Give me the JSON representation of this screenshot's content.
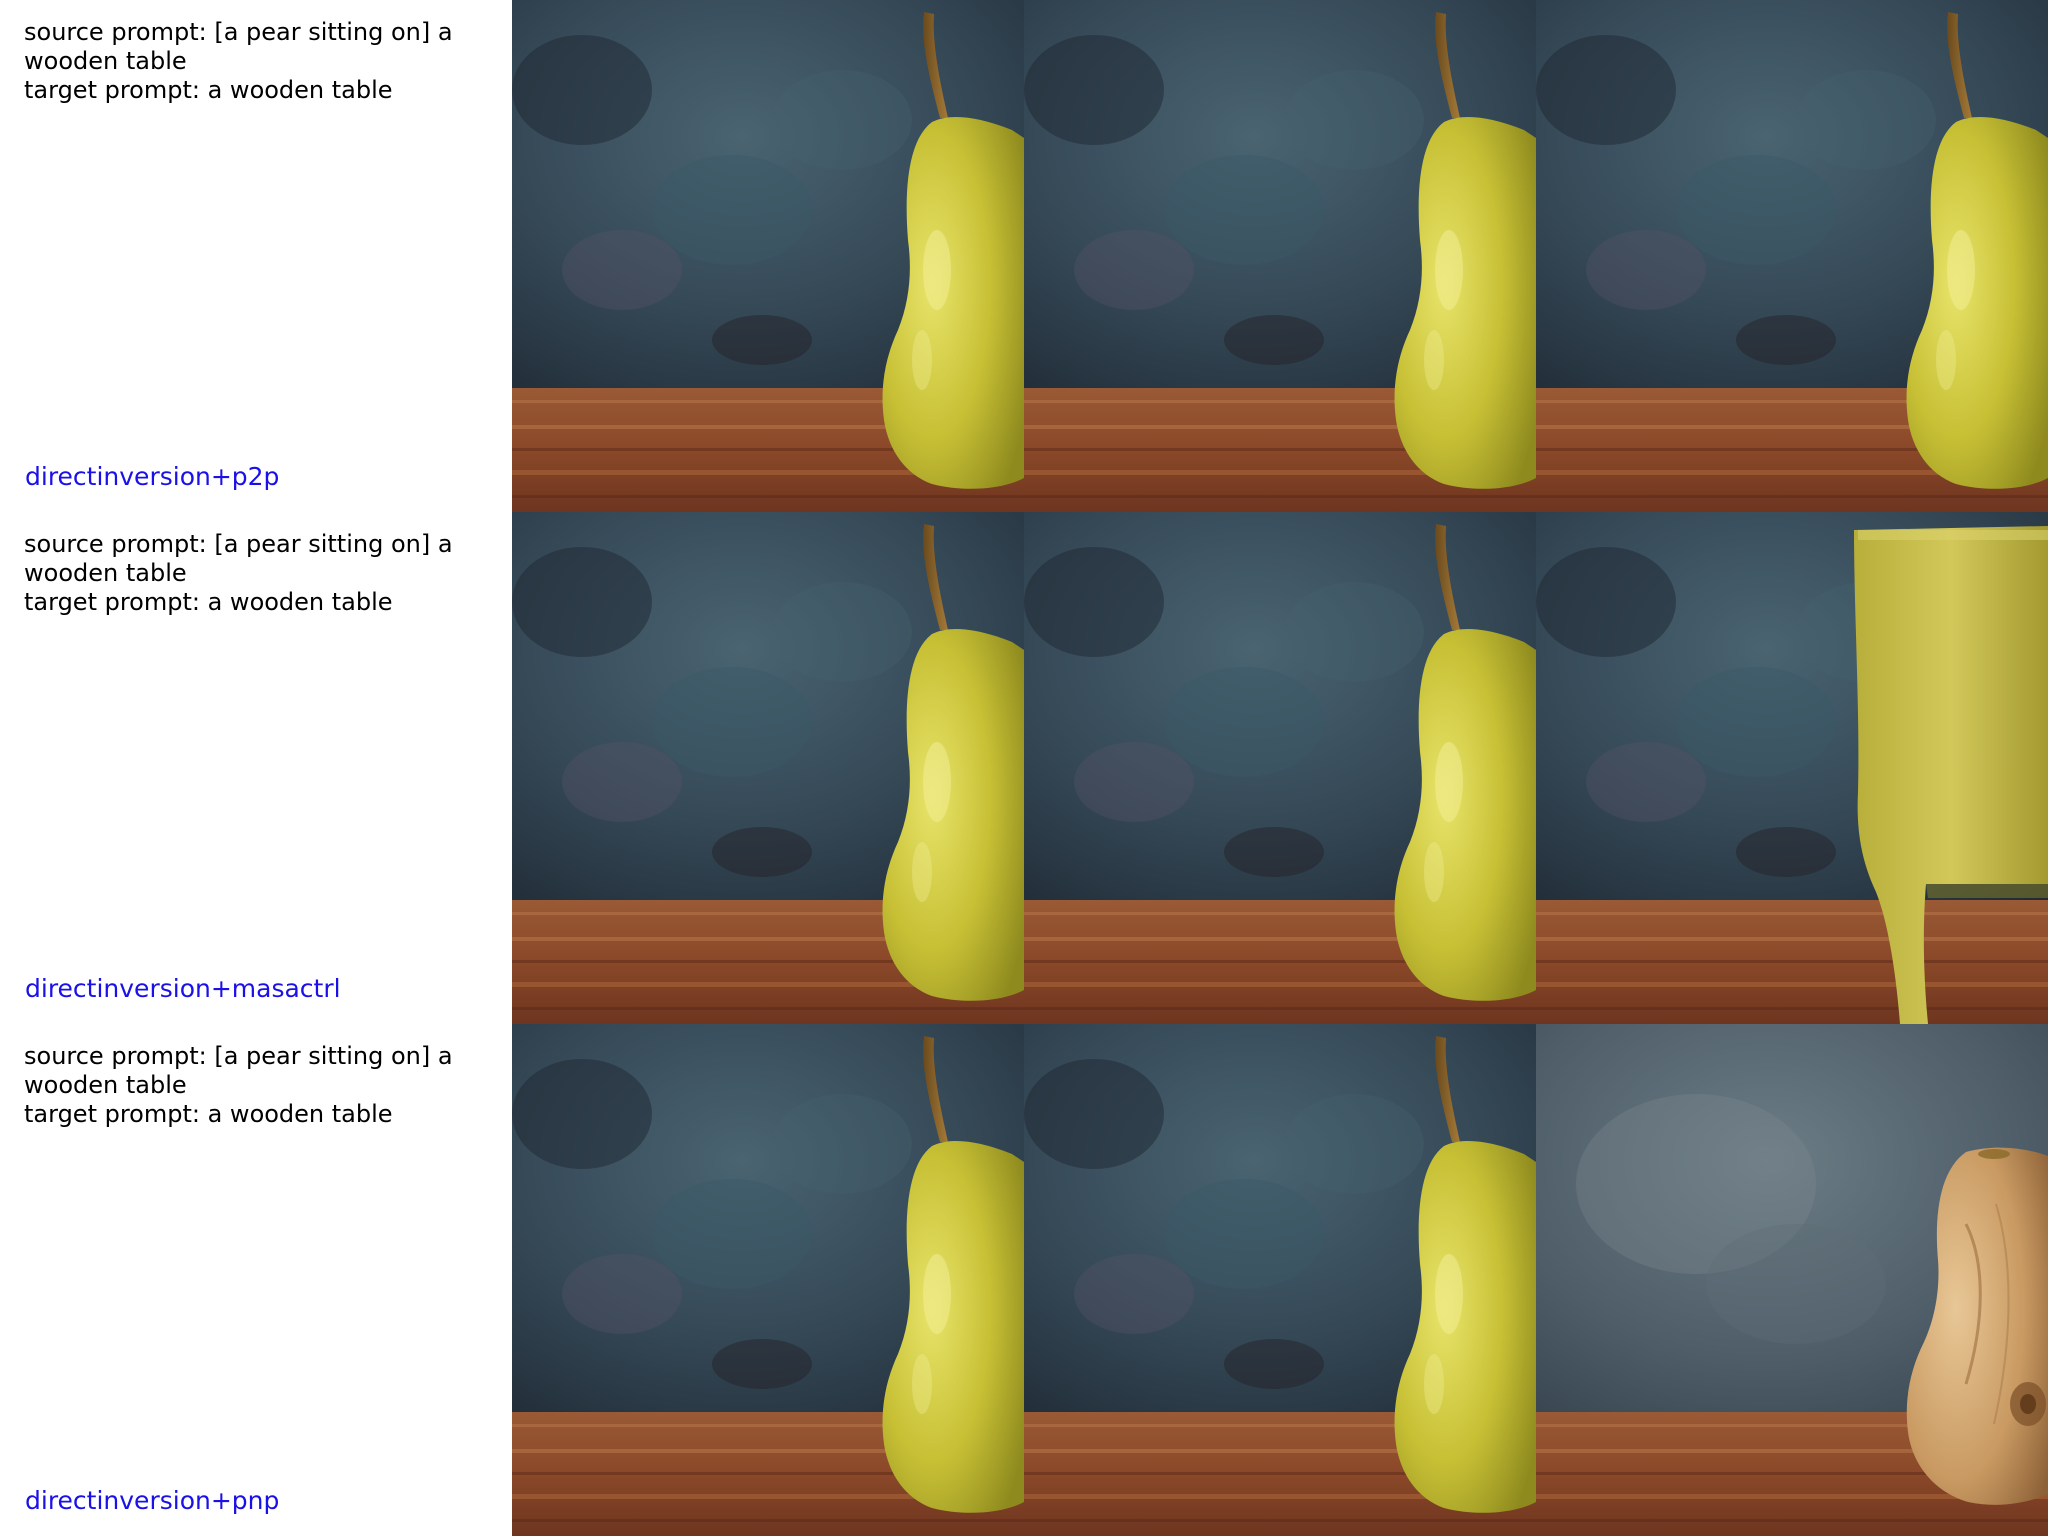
{
  "rows": [
    {
      "source_prompt": "source prompt: [a pear sitting on] a",
      "source_prompt_cont": "wooden table",
      "target_prompt": "target prompt: a wooden table",
      "method": "directinversion+p2p",
      "result_subject": "pear"
    },
    {
      "source_prompt": "source prompt: [a pear sitting on] a",
      "source_prompt_cont": "wooden table",
      "target_prompt": "target prompt: a wooden table",
      "method": "directinversion+masactrl",
      "result_subject": "yellow-table"
    },
    {
      "source_prompt": "source prompt: [a pear sitting on] a",
      "source_prompt_cont": "wooden table",
      "target_prompt": "target prompt: a wooden table",
      "method": "directinversion+pnp",
      "result_subject": "wooden-pear"
    }
  ],
  "colors": {
    "method_label": "#1a10e8",
    "prompt_text": "#000000",
    "background_dark": "#2c3a47",
    "table_wood": "#8a4a2a",
    "pear_yellow": "#c9c23a"
  }
}
